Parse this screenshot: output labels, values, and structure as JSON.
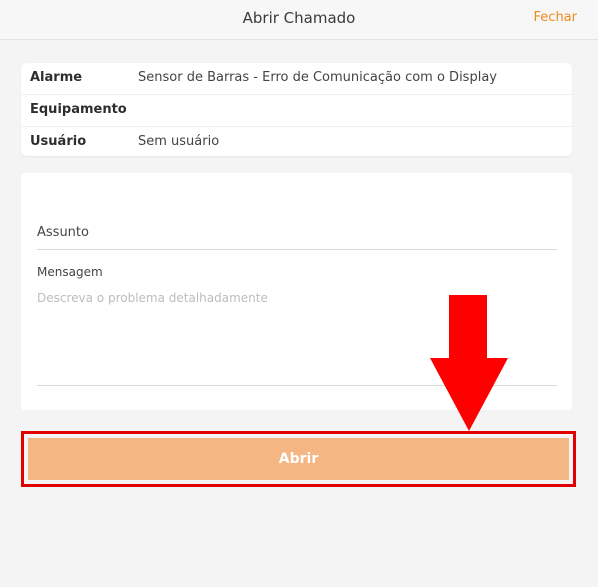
{
  "header": {
    "title": "Abrir Chamado",
    "close_label": "Fechar"
  },
  "info": {
    "rows": [
      {
        "label": "Alarme",
        "value": "Sensor de Barras - Erro de Comunicação com o Display"
      },
      {
        "label": "Equipamento",
        "value": ""
      },
      {
        "label": "Usuário",
        "value": "Sem usuário"
      }
    ]
  },
  "form": {
    "subject_placeholder": "Assunto",
    "message_label": "Mensagem",
    "message_placeholder": "Descreva o problema detalhadamente"
  },
  "actions": {
    "open_label": "Abrir"
  },
  "colors": {
    "accent": "#f08a1c",
    "button": "#f4b682",
    "highlight": "#e00000"
  },
  "annotation": {
    "arrow_icon": "down-arrow-icon"
  }
}
